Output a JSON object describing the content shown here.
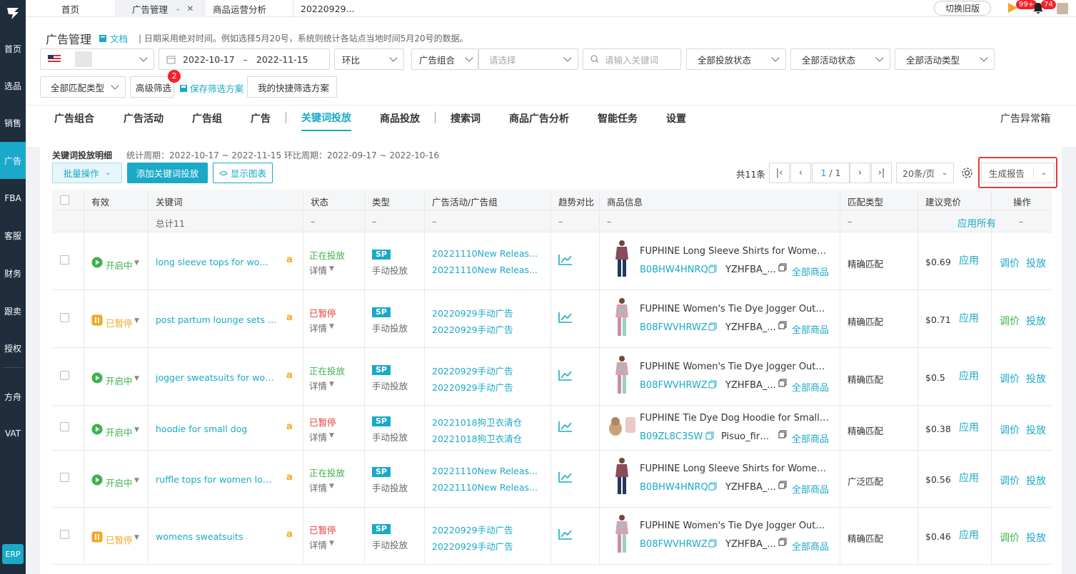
{
  "nav": {
    "items": [
      "首页",
      "选品",
      "销售",
      "广告",
      "FBA",
      "客服",
      "财务",
      "跟卖",
      "授权",
      "方舟",
      "VAT"
    ],
    "erp": "ERP"
  },
  "tabs": {
    "home": "首页",
    "ads": "广告管理",
    "analysis": "商品运营分析",
    "other": "20220929..."
  },
  "topright": {
    "old_version": "切换旧版",
    "badge1": "99+",
    "badge2": "74"
  },
  "header": {
    "title": "广告管理",
    "doc": "文档",
    "hint": "日期采用绝对时间。例如选择5月20号，系统则统计各站点当地时间5月20号的数据。"
  },
  "filters": {
    "date_from": "2022-10-17",
    "date_sep": "–",
    "date_to": "2022-11-15",
    "compare": "环比",
    "group_label": "广告组合",
    "group_placeholder": "请选择",
    "keyword_placeholder": "请输入关键词",
    "status_all": "全部投放状态",
    "activity_all": "全部活动状态",
    "type_all": "全部活动类型",
    "match_all": "全部匹配类型",
    "advanced": "高级筛选",
    "advanced_badge": "2",
    "save_plan": "保存筛选方案",
    "my_plans": "我的快捷筛选方案"
  },
  "navtabs": [
    "广告组合",
    "广告活动",
    "广告组",
    "广告",
    "关键词投放",
    "商品投放",
    "搜索词",
    "商品广告分析",
    "智能任务",
    "设置"
  ],
  "anomaly": "广告异常箱",
  "card": {
    "title": "关键词投放明细",
    "meta": "统计周期：2022-10-17 ~ 2022-11-15  环比周期：2022-09-17 ~ 2022-10-16",
    "bulk": "批量操作",
    "add": "添加关键词投放",
    "chart": "显示图表",
    "total": "共11条",
    "page_current": "1",
    "page_total": "/ 1",
    "page_size": "20条/页",
    "report": "生成报告"
  },
  "table": {
    "headers": [
      "有效",
      "关键词",
      "状态",
      "类型",
      "广告活动/广告组",
      "趋势对比",
      "商品信息",
      "匹配类型",
      "建议竞价",
      "操作"
    ],
    "summary": {
      "label": "总计11",
      "dash": "–",
      "apply_all": "应用所有"
    },
    "rows": [
      {
        "valid": "开启中",
        "valid_state": "on",
        "keyword": "long sleeve tops for women",
        "status": "正在投放",
        "status_state": "on",
        "detail": "详情",
        "type": "SP",
        "type_sub": "手动投放",
        "campaign": "20221110New Releas...",
        "group": "20221110New Releas...",
        "product": "FUPHINE Long Sleeve Shirts for Women ...",
        "asin": "B0BHW4HNRQ",
        "sku": "YZHFBA_...",
        "all_goods": "全部商品",
        "match": "精确匹配",
        "bid": "$0.69",
        "apply": "应用",
        "adjust": "调价",
        "deliver": "投放",
        "img": "shirt"
      },
      {
        "valid": "已暂停",
        "valid_state": "off",
        "keyword": "post partum lounge sets for ...",
        "status": "已暂停",
        "status_state": "off",
        "detail": "详情",
        "type": "SP",
        "type_sub": "手动投放",
        "campaign": "20220929手动广告",
        "group": "20220929手动广告",
        "product": "FUPHINE Women's Tie Dye Jogger Outfit...",
        "asin": "B08FWVHRWZ",
        "sku": "YZHFBA_...",
        "all_goods": "全部商品",
        "match": "精确匹配",
        "bid": "$0.71",
        "apply": "应用",
        "adjust": "调价",
        "deliver": "投放",
        "img": "tiedye"
      },
      {
        "valid": "开启中",
        "valid_state": "on",
        "keyword": "jogger sweatsuits for women ...",
        "status": "正在投放",
        "status_state": "on",
        "detail": "详情",
        "type": "SP",
        "type_sub": "手动投放",
        "campaign": "20220929手动广告",
        "group": "20220929手动广告",
        "product": "FUPHINE Women's Tie Dye Jogger Outfit...",
        "asin": "B08FWVHRWZ",
        "sku": "YZHFBA_...",
        "all_goods": "全部商品",
        "match": "精确匹配",
        "bid": "$0.5",
        "apply": "应用",
        "adjust": "调价",
        "deliver": "投放",
        "img": "tiedye"
      },
      {
        "valid": "开启中",
        "valid_state": "on",
        "keyword": "hoodie for small dog",
        "status": "已暂停",
        "status_state": "off",
        "detail": "详情",
        "type": "SP",
        "type_sub": "手动投放",
        "campaign": "20221018狗卫衣清仓",
        "group": "20221018狗卫衣清仓",
        "product": "FUPHINE Tie Dye Dog Hoodie for Small ...",
        "asin": "B09ZL8C3SW",
        "sku": "Pisuo_firs...",
        "all_goods": "全部商品",
        "match": "精确匹配",
        "bid": "$0.38",
        "apply": "应用",
        "adjust": "调价",
        "deliver": "投放",
        "img": "dog"
      },
      {
        "valid": "开启中",
        "valid_state": "on",
        "keyword": "ruffle tops for women long sle...",
        "status": "正在投放",
        "status_state": "on",
        "detail": "详情",
        "type": "SP",
        "type_sub": "手动投放",
        "campaign": "20221110New Releas...",
        "group": "20221110New Releas...",
        "product": "FUPHINE Long Sleeve Shirts for Women ...",
        "asin": "B0BHW4HNRQ",
        "sku": "YZHFBA_...",
        "all_goods": "全部商品",
        "match": "广泛匹配",
        "bid": "$0.56",
        "apply": "应用",
        "adjust": "调价",
        "deliver": "投放",
        "img": "shirt"
      },
      {
        "valid": "已暂停",
        "valid_state": "off",
        "keyword": "womens sweatsuits",
        "status": "已暂停",
        "status_state": "off",
        "detail": "详情",
        "type": "SP",
        "type_sub": "手动投放",
        "campaign": "20220929手动广告",
        "group": "20220929手动广告",
        "product": "FUPHINE Women's Tie Dye Jogger Outfit...",
        "asin": "B08FWVHRWZ",
        "sku": "YZHFBA_...",
        "all_goods": "全部商品",
        "match": "精确匹配",
        "bid": "$0.46",
        "apply": "应用",
        "adjust": "调价",
        "deliver": "投放",
        "img": "tiedye"
      }
    ]
  },
  "colors": {
    "accent": "#1aa9c8",
    "green": "#3cb34a",
    "red": "#e53935",
    "orange": "#f5a623",
    "nav": "#1f2d3d"
  }
}
